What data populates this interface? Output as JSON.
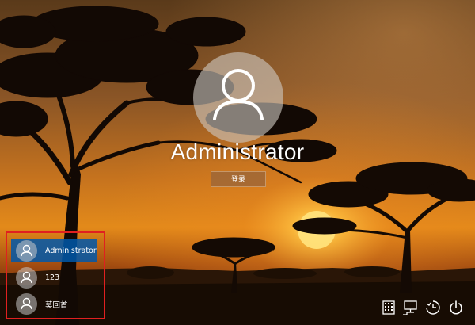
{
  "current_user": {
    "name": "Administrator",
    "sign_in_label": "登录"
  },
  "user_list": [
    {
      "name": "Administrator",
      "selected": true
    },
    {
      "name": "123",
      "selected": false
    },
    {
      "name": "莫回首",
      "selected": false
    }
  ],
  "system_icons": [
    "keyboard-icon",
    "network-icon",
    "ease-of-access-icon",
    "power-icon"
  ],
  "colors": {
    "selected_user_bg": "#0058aa",
    "highlight_border": "#e02020",
    "sun": "#ffe27a"
  }
}
